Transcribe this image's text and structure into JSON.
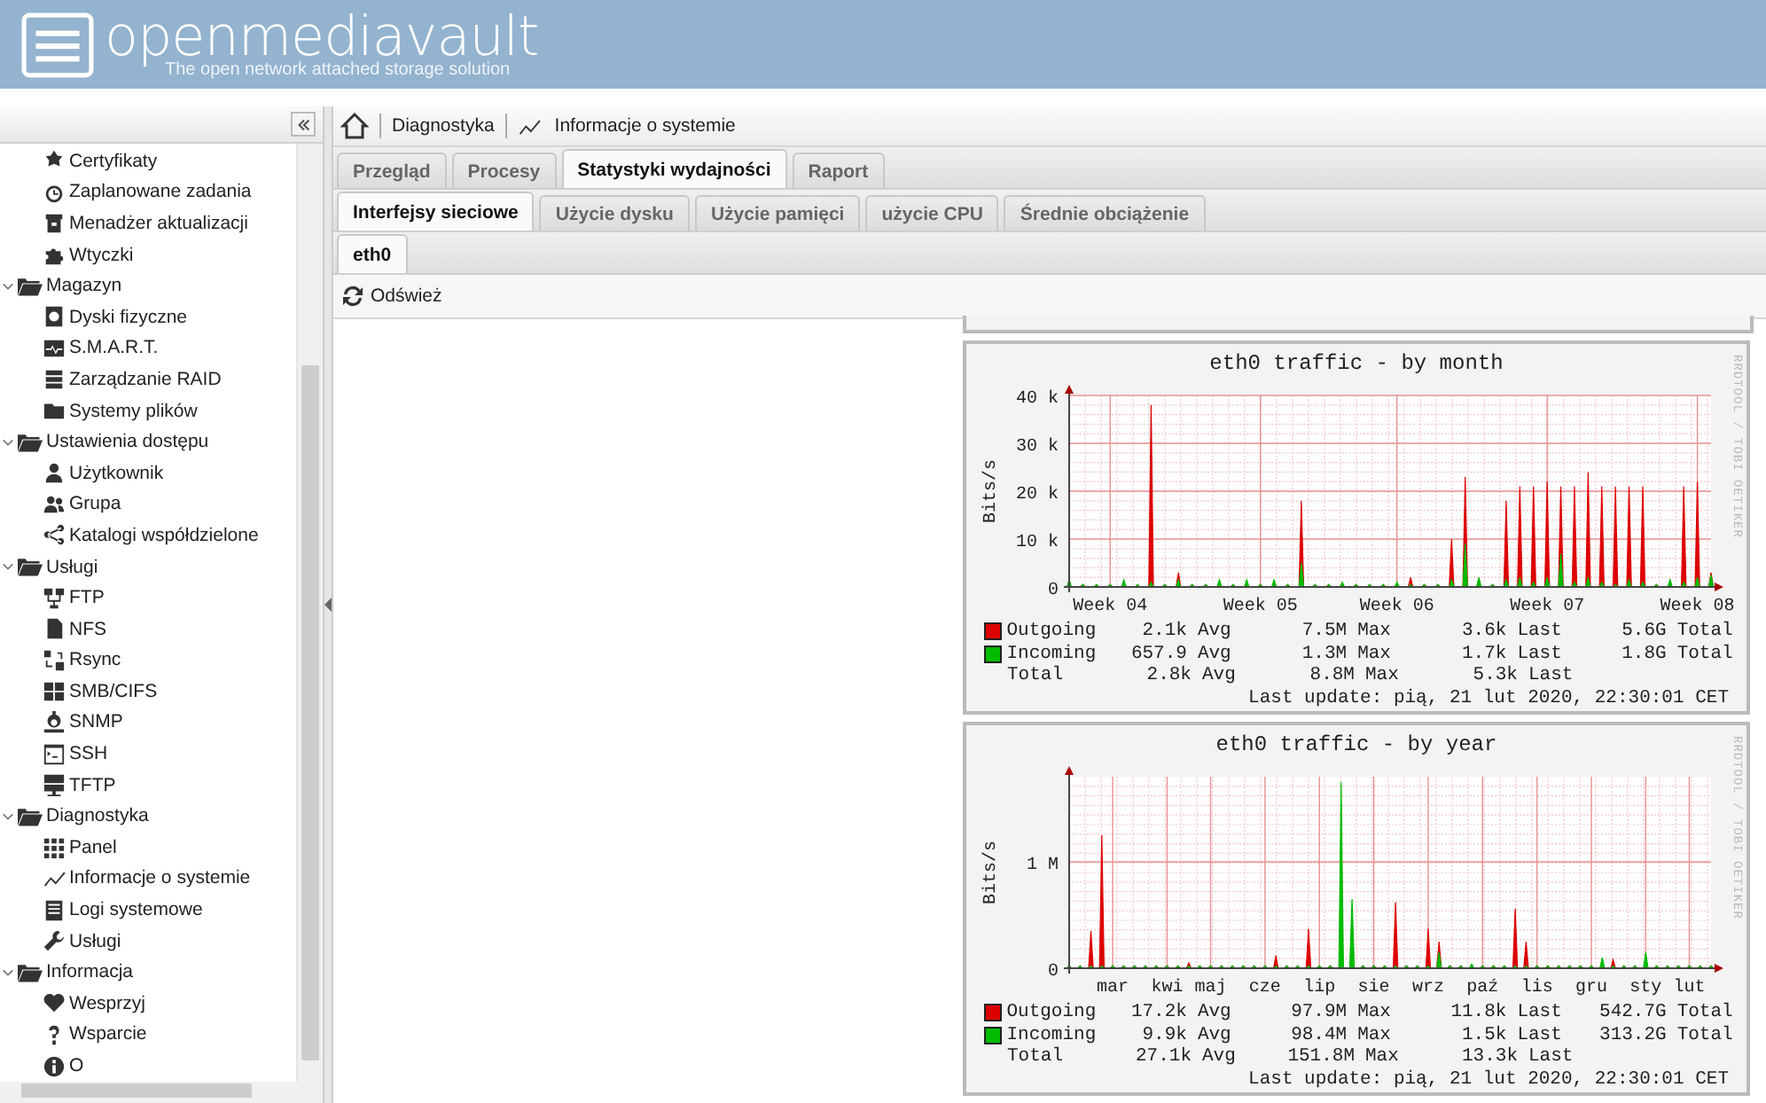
{
  "header": {
    "logo": "openmediavault",
    "tagline": "The open network attached storage solution"
  },
  "sidebar": {
    "partial_group_children": [
      {
        "label": "Certyfikaty"
      },
      {
        "label": "Zaplanowane zadania"
      },
      {
        "label": "Menadżer aktualizacji"
      },
      {
        "label": "Wtyczki"
      }
    ],
    "groups": [
      {
        "label": "Magazyn",
        "expanded": true,
        "children": [
          {
            "label": "Dyski fizyczne"
          },
          {
            "label": "S.M.A.R.T."
          },
          {
            "label": "Zarządzanie RAID"
          },
          {
            "label": "Systemy plików"
          }
        ]
      },
      {
        "label": "Ustawienia dostępu",
        "expanded": true,
        "children": [
          {
            "label": "Użytkownik"
          },
          {
            "label": "Grupa"
          },
          {
            "label": "Katalogi współdzielone"
          }
        ]
      },
      {
        "label": "Usługi",
        "expanded": true,
        "children": [
          {
            "label": "FTP"
          },
          {
            "label": "NFS"
          },
          {
            "label": "Rsync"
          },
          {
            "label": "SMB/CIFS"
          },
          {
            "label": "SNMP"
          },
          {
            "label": "SSH"
          },
          {
            "label": "TFTP"
          }
        ]
      },
      {
        "label": "Diagnostyka",
        "expanded": true,
        "children": [
          {
            "label": "Panel"
          },
          {
            "label": "Informacje o systemie"
          },
          {
            "label": "Logi systemowe"
          },
          {
            "label": "Usługi"
          }
        ]
      },
      {
        "label": "Informacja",
        "expanded": true,
        "children": [
          {
            "label": "Wesprzyj"
          },
          {
            "label": "Wsparcie"
          },
          {
            "label": "O"
          }
        ]
      }
    ]
  },
  "breadcrumb": [
    "Diagnostyka",
    "Informacje o systemie"
  ],
  "tabs": [
    {
      "label": "Przegląd",
      "selected": false
    },
    {
      "label": "Procesy",
      "selected": false
    },
    {
      "label": "Statystyki wydajności",
      "selected": true
    },
    {
      "label": "Raport",
      "selected": false
    }
  ],
  "subtabs": [
    {
      "label": "Interfejsy sieciowe",
      "selected": true
    },
    {
      "label": "Użycie dysku",
      "selected": false
    },
    {
      "label": "Użycie pamięci",
      "selected": false
    },
    {
      "label": "użycie CPU",
      "selected": false
    },
    {
      "label": "Średnie obciążenie",
      "selected": false
    }
  ],
  "interface_tabs": [
    {
      "label": "eth0",
      "selected": true
    }
  ],
  "toolbar": {
    "refresh": "Odśwież"
  },
  "graphs": [
    {
      "watermark": "RRDTOOL / TOBI OETIKER",
      "last_update": "Last update: pią, 21 lut 2020, 22:30:01 CET",
      "legend": [
        {
          "stats": [
            {
              "value": "2.1k",
              "unit": "Avg"
            },
            {
              "value": "7.5M",
              "unit": "Max"
            },
            {
              "value": "3.6k",
              "unit": "Last"
            },
            {
              "value": "5.6G",
              "unit": "Total"
            }
          ]
        },
        {
          "stats": [
            {
              "value": "657.9",
              "unit": "Avg"
            },
            {
              "value": "1.3M",
              "unit": "Max"
            },
            {
              "value": "1.7k",
              "unit": "Last"
            },
            {
              "value": "1.8G",
              "unit": "Total"
            }
          ]
        },
        {
          "name": "Total",
          "stats": [
            {
              "value": "2.8k",
              "unit": "Avg"
            },
            {
              "value": "8.8M",
              "unit": "Max"
            },
            {
              "value": "5.3k",
              "unit": "Last"
            }
          ]
        }
      ],
      "chart_data": {
        "type": "area",
        "title": "eth0 traffic - by month",
        "ylabel": "Bits/s",
        "grid": true,
        "ylim": [
          0,
          40000
        ],
        "categories": [
          null,
          null,
          null,
          "Week 04",
          null,
          null,
          null,
          null,
          null,
          null,
          null,
          null,
          null,
          null,
          "Week 05",
          null,
          null,
          null,
          null,
          null,
          null,
          null,
          null,
          null,
          "Week 06",
          null,
          null,
          null,
          null,
          null,
          null,
          null,
          null,
          null,
          null,
          "Week 07",
          null,
          null,
          null,
          null,
          null,
          null,
          null,
          null,
          null,
          null,
          "Week 08",
          null
        ],
        "yticks": [
          {
            "value": 0,
            "label": "0"
          },
          {
            "value": 10000,
            "label": "10 k"
          },
          {
            "value": 20000,
            "label": "20 k"
          },
          {
            "value": 30000,
            "label": "30 k"
          },
          {
            "value": 40000,
            "label": "40 k"
          }
        ],
        "series": [
          {
            "name": "Outgoing",
            "color": "#dd0000",
            "values": [
              0,
              0,
              0,
              0,
              0,
              0,
              38000,
              0,
              3000,
              0,
              0,
              0,
              0,
              0,
              0,
              0,
              0,
              18000,
              0,
              0,
              0,
              0,
              0,
              0,
              0,
              2000,
              0,
              0,
              10000,
              23000,
              0,
              0,
              18000,
              21000,
              21000,
              22000,
              21000,
              21000,
              24000,
              21000,
              21000,
              21000,
              21000,
              0,
              0,
              21000,
              22000,
              3000
            ]
          },
          {
            "name": "Incoming",
            "color": "#00bb00",
            "values": [
              1500,
              0,
              0,
              0,
              1500,
              0,
              1000,
              0,
              1500,
              0,
              0,
              1500,
              0,
              1500,
              0,
              1500,
              0,
              5000,
              0,
              0,
              1000,
              0,
              0,
              0,
              1000,
              0,
              0,
              0,
              1500,
              9000,
              2000,
              0,
              1500,
              2000,
              1000,
              2000,
              7000,
              1000,
              2000,
              1000,
              0,
              1500,
              1000,
              0,
              1500,
              1000,
              2000,
              2500
            ]
          }
        ]
      }
    },
    {
      "watermark": "RRDTOOL / TOBI OETIKER",
      "last_update": "Last update: pią, 21 lut 2020, 22:30:01 CET",
      "legend": [
        {
          "stats": [
            {
              "value": "17.2k",
              "unit": "Avg"
            },
            {
              "value": "97.9M",
              "unit": "Max"
            },
            {
              "value": "11.8k",
              "unit": "Last"
            },
            {
              "value": "542.7G",
              "unit": "Total"
            }
          ]
        },
        {
          "stats": [
            {
              "value": "9.9k",
              "unit": "Avg"
            },
            {
              "value": "98.4M",
              "unit": "Max"
            },
            {
              "value": "1.5k",
              "unit": "Last"
            },
            {
              "value": "313.2G",
              "unit": "Total"
            }
          ]
        },
        {
          "name": "Total",
          "stats": [
            {
              "value": "27.1k",
              "unit": "Avg"
            },
            {
              "value": "151.8M",
              "unit": "Max"
            },
            {
              "value": "13.3k",
              "unit": "Last"
            }
          ]
        }
      ],
      "chart_data": {
        "type": "area",
        "title": "eth0 traffic - by year",
        "ylabel": "Bits/s",
        "grid": true,
        "ylim": [
          0,
          1800000
        ],
        "categories": [
          null,
          null,
          null,
          null,
          "mar",
          null,
          null,
          null,
          null,
          "kwi",
          null,
          null,
          null,
          "maj",
          null,
          null,
          null,
          null,
          "cze",
          null,
          null,
          null,
          null,
          "lip",
          null,
          null,
          null,
          null,
          "sie",
          null,
          null,
          null,
          null,
          "wrz",
          null,
          null,
          null,
          null,
          "paź",
          null,
          null,
          null,
          null,
          "lis",
          null,
          null,
          null,
          null,
          "gru",
          null,
          null,
          null,
          null,
          "sty",
          null,
          null,
          null,
          "lut",
          null,
          null
        ],
        "yticks": [
          {
            "value": 0,
            "label": "0"
          },
          {
            "value": 1000000,
            "label": "1 M"
          }
        ],
        "series": [
          {
            "name": "Outgoing",
            "color": "#dd0000",
            "values": [
              0,
              0,
              350000,
              1250000,
              0,
              0,
              0,
              0,
              0,
              0,
              0,
              50000,
              0,
              0,
              0,
              0,
              0,
              0,
              0,
              120000,
              0,
              0,
              370000,
              0,
              0,
              0,
              0,
              0,
              0,
              0,
              620000,
              0,
              0,
              370000,
              250000,
              0,
              0,
              0,
              0,
              0,
              0,
              560000,
              250000,
              0,
              0,
              0,
              0,
              0,
              0,
              0,
              80000,
              0,
              0,
              0,
              0,
              0,
              0,
              0,
              0,
              0
            ]
          },
          {
            "name": "Incoming",
            "color": "#00bb00",
            "values": [
              0,
              0,
              0,
              0,
              0,
              0,
              0,
              0,
              0,
              0,
              0,
              0,
              0,
              0,
              0,
              0,
              0,
              0,
              0,
              0,
              0,
              0,
              0,
              0,
              0,
              1750000,
              650000,
              0,
              0,
              0,
              0,
              0,
              0,
              0,
              150000,
              0,
              0,
              40000,
              0,
              0,
              0,
              0,
              0,
              0,
              0,
              0,
              0,
              0,
              0,
              100000,
              0,
              0,
              0,
              150000,
              0,
              0,
              0,
              0,
              0,
              0
            ]
          }
        ]
      }
    }
  ]
}
